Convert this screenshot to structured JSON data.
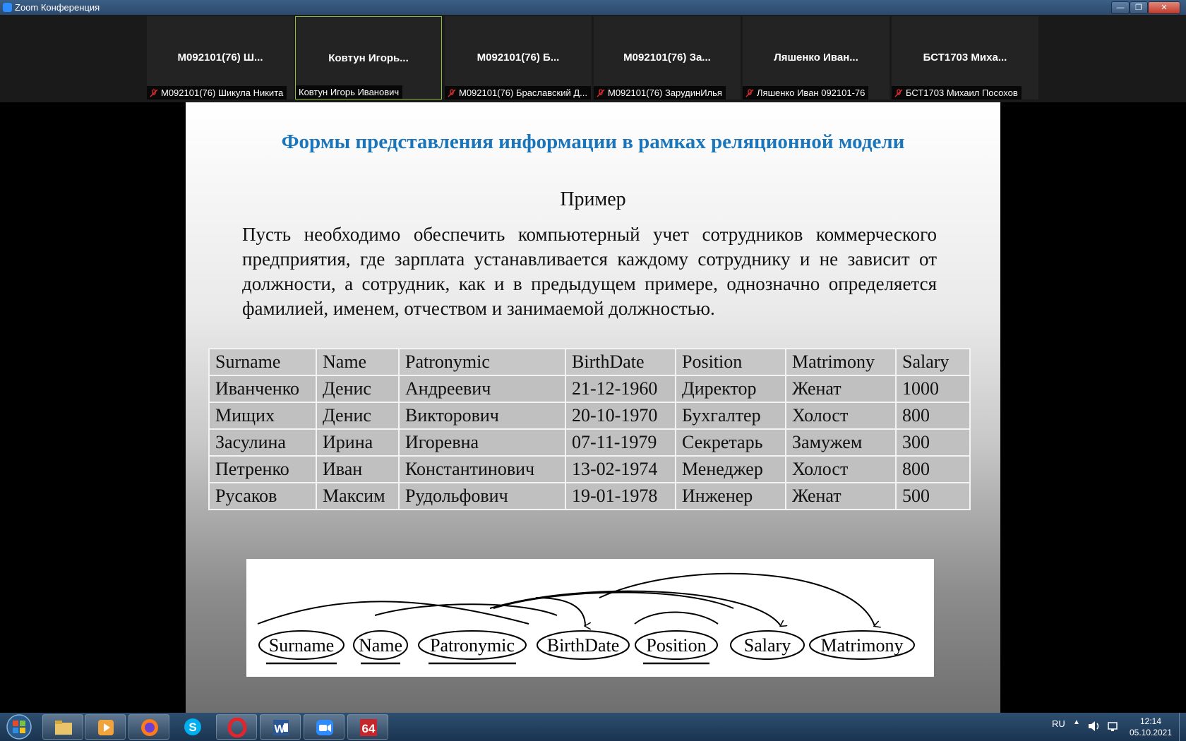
{
  "window": {
    "title": "Zoom Конференция",
    "buttons": [
      "—",
      "❐",
      "✕"
    ]
  },
  "participants": [
    {
      "name": "М092101(76) Ш...",
      "label": "М092101(76) Шикула Никита",
      "muted": true,
      "active": false
    },
    {
      "name": "Ковтун Игорь...",
      "label": "Ковтун Игорь Иванович",
      "muted": false,
      "active": true
    },
    {
      "name": "М092101(76) Б...",
      "label": "М092101(76) Браславский Д...",
      "muted": true,
      "active": false
    },
    {
      "name": "М092101(76) За...",
      "label": "М092101(76) ЗарудинИлья",
      "muted": true,
      "active": false
    },
    {
      "name": "Ляшенко Иван...",
      "label": "Ляшенко Иван 092101-76",
      "muted": true,
      "active": false
    },
    {
      "name": "БСТ1703 Миха...",
      "label": "БСТ1703 Михаил Посохов",
      "muted": true,
      "active": false
    }
  ],
  "slide": {
    "title": "Формы представления информации в рамках реляционной модели",
    "subtitle": "Пример",
    "paragraph": "Пусть необходимо обеспечить компьютерный учет сотрудников коммерческого предприятия, где зарплата устанавливается каждому сотруднику и не зависит от должности, а сотрудник, как и в предыдущем примере, однозначно определяется фамилией, именем, отчеством и занимаемой должностью.",
    "table": {
      "headers": [
        "Surname",
        "Name",
        "Patronymic",
        "BirthDate",
        "Position",
        "Matrimony",
        "Salary"
      ],
      "rows": [
        [
          "Иванченко",
          "Денис",
          "Андреевич",
          "21-12-1960",
          "Директор",
          "Женат",
          "1000"
        ],
        [
          "Мищих",
          "Денис",
          "Викторович",
          "20-10-1970",
          "Бухгалтер",
          "Холост",
          "800"
        ],
        [
          "Засулина",
          "Ирина",
          "Игоревна",
          "07-11-1979",
          "Секретарь",
          "Замужем",
          "300"
        ],
        [
          "Петренко",
          "Иван",
          "Константинович",
          "13-02-1974",
          "Менеджер",
          "Холост",
          "800"
        ],
        [
          "Русаков",
          "Максим",
          "Рудольфович",
          "19-01-1978",
          "Инженер",
          "Женат",
          "500"
        ]
      ]
    },
    "diagram_nodes": [
      "Surname",
      "Name",
      "Patronymic",
      "BirthDate",
      "Position",
      "Salary",
      "Matrimony"
    ],
    "underlined_keys": [
      "Surname",
      "Name",
      "Patronymic",
      "Position"
    ]
  },
  "taskbar": {
    "apps": [
      "file-explorer",
      "media-player",
      "firefox",
      "skype",
      "opera",
      "word",
      "zoom",
      "aida64"
    ],
    "aida_label": "64",
    "word_label": "W",
    "language": "RU",
    "time": "12:14",
    "date": "05.10.2021"
  },
  "colors": {
    "slide_title": "#1b75bb",
    "active_tile_border": "#8fbf3a",
    "mute_red": "#e02f2f"
  }
}
